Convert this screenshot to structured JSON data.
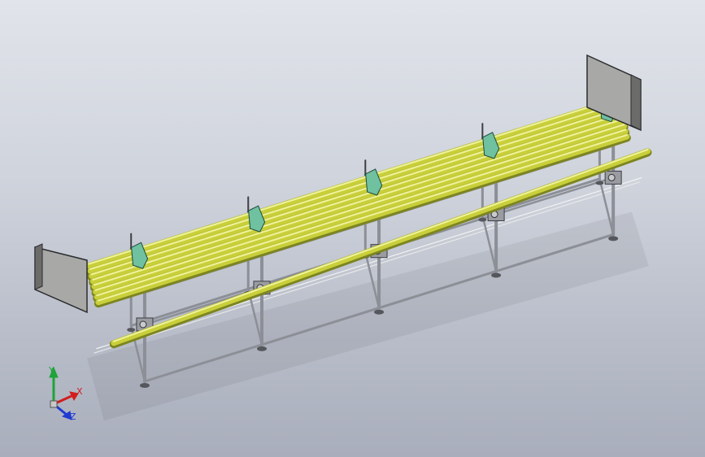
{
  "viewport": {
    "background_top": "#e1e4ea",
    "background_bottom": "#a9aebc"
  },
  "model": {
    "tube_color": "#c9cf3a",
    "frame_color": "#8c8f96",
    "bracket_color": "#6fc1a0",
    "panel_color": "#a8a9a6",
    "tube_count": 8,
    "bay_count": 4
  },
  "triad": {
    "x_label": "X",
    "y_label": "Y",
    "z_label": "Z",
    "x_color": "#d21e1e",
    "y_color": "#1fa33a",
    "z_color": "#1e3ad2"
  }
}
